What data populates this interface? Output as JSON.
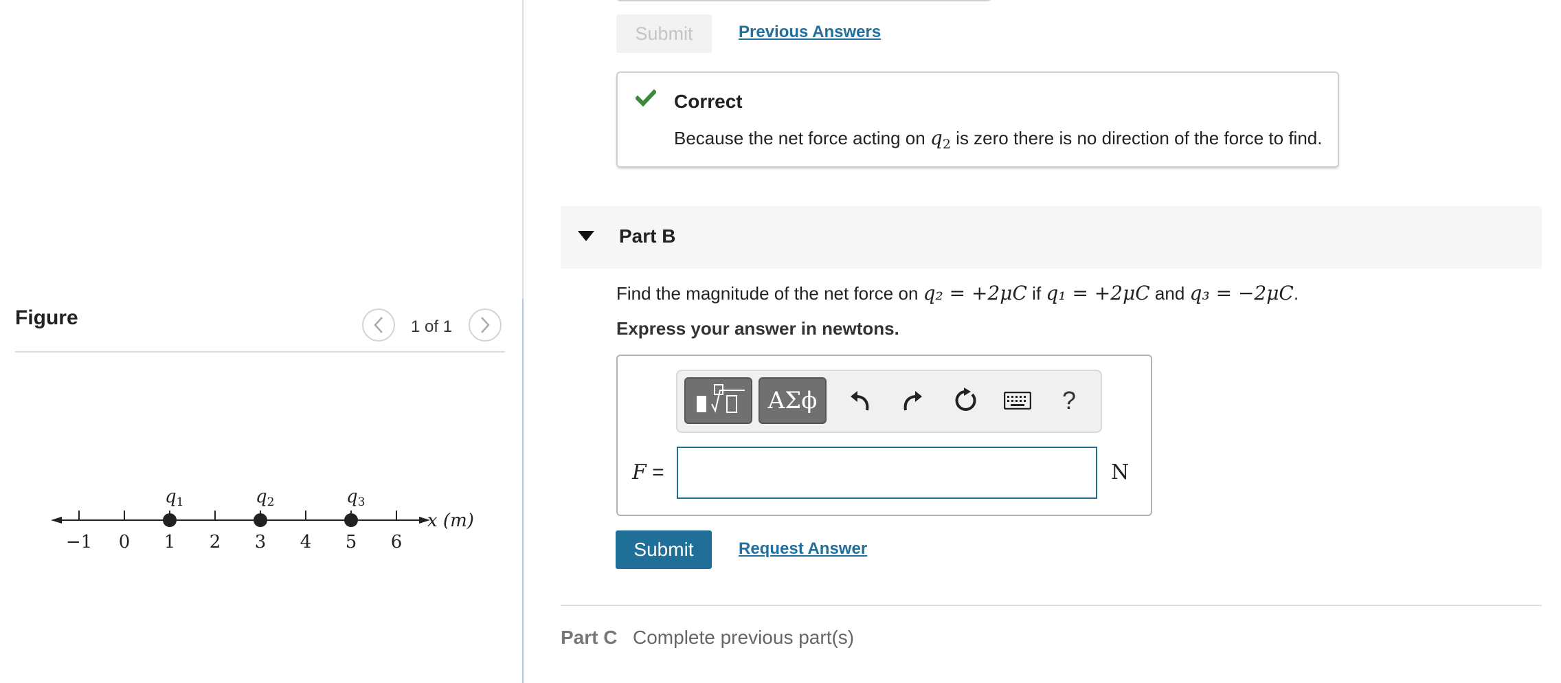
{
  "figure_panel": {
    "title": "Figure",
    "counter": "1 of 1",
    "prev_icon": "chevron-left-icon",
    "next_icon": "chevron-right-icon",
    "diagram": {
      "tick_labels": [
        "−1",
        "0",
        "1",
        "2",
        "3",
        "4",
        "5",
        "6"
      ],
      "charges": [
        {
          "label": "q",
          "sub": "1",
          "position": 1
        },
        {
          "label": "q",
          "sub": "2",
          "position": 3
        },
        {
          "label": "q",
          "sub": "3",
          "position": 5
        }
      ],
      "axis_label": "x (m)"
    }
  },
  "part_a": {
    "submit_label": "Submit",
    "previous_answers_label": "Previous Answers",
    "feedback": {
      "icon": "checkmark-icon",
      "title": "Correct",
      "message_before": "Because the net force acting on ",
      "message_var": "q",
      "message_sub": "2",
      "message_after": " is zero there is no direction of the force to find."
    }
  },
  "part_b": {
    "title": "Part B",
    "question": {
      "t1": "Find the magnitude of the net force on ",
      "m1": "q₂ = +2μC",
      "t2": " if ",
      "m2": "q₁ = +2μC",
      "t3": " and ",
      "m3": "q₃ = −2μC",
      "t4": "."
    },
    "instruction": "Express your answer in newtons.",
    "toolbar": {
      "greek_label": "ΑΣϕ",
      "help_label": "?"
    },
    "variable": "F",
    "equals": " =",
    "answer_value": "",
    "unit": "N",
    "submit_label": "Submit",
    "request_answer_label": "Request Answer"
  },
  "part_c": {
    "label": "Part C",
    "status": "Complete previous part(s)"
  },
  "colors": {
    "link": "#1f6f9f",
    "submit_active": "#1f6f98",
    "correct_check": "#3a8a3a"
  }
}
